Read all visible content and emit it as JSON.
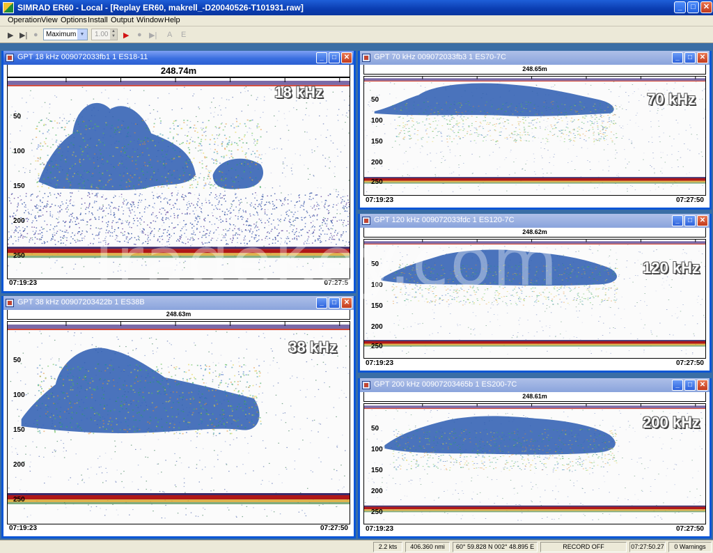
{
  "app": {
    "title": "SIMRAD ER60 - Local - [Replay ER60, makrell_-D20040526-T101931.raw]",
    "minimize": "_",
    "maximize": "□",
    "close": "✕"
  },
  "menu": [
    "Operation",
    "View",
    "Options",
    "Install",
    "Output",
    "Window",
    "Help"
  ],
  "toolbar": {
    "play": "▶",
    "step": "▶|",
    "stop": "●",
    "speed_value": "Maximum",
    "spin_value": "1.00",
    "record": "▶",
    "record_dot": "●",
    "pause": "▶|",
    "a": "A",
    "e": "E"
  },
  "windows": [
    {
      "id": "w18",
      "title": "GPT  18 kHz 009072033fb1 1 ES18-11",
      "range": "248.74m",
      "freq": "18 kHz",
      "depth_ticks": [
        "50",
        "100",
        "150",
        "200",
        "250"
      ],
      "time_start": "07:19:23",
      "time_end": "07:27:5"
    },
    {
      "id": "w38",
      "title": "GPT  38 kHz 00907203422b 1 ES38B",
      "range": "248.63m",
      "freq": "38 kHz",
      "depth_ticks": [
        "50",
        "100",
        "150",
        "200",
        "250"
      ],
      "time_start": "07:19:23",
      "time_end": "07:27:50"
    },
    {
      "id": "w70",
      "title": "GPT  70 kHz 009072033fb3 1 ES70-7C",
      "range": "248.65m",
      "freq": "70 kHz",
      "depth_ticks": [
        "50",
        "100",
        "150",
        "200",
        "250"
      ],
      "time_start": "07:19:23",
      "time_end": "07:27:50"
    },
    {
      "id": "w120",
      "title": "GPT 120 kHz 009072033fdc 1 ES120-7C",
      "range": "248.62m",
      "freq": "120 kHz",
      "depth_ticks": [
        "50",
        "100",
        "150",
        "200",
        "250"
      ],
      "time_start": "07:19:23",
      "time_end": "07:27:50"
    },
    {
      "id": "w200",
      "title": "GPT 200 kHz 00907203465b 1 ES200-7C",
      "range": "248.61m",
      "freq": "200 kHz",
      "depth_ticks": [
        "50",
        "100",
        "150",
        "200",
        "250"
      ],
      "time_start": "07:19:23",
      "time_end": "07:27:50"
    }
  ],
  "status": {
    "speed": "2.2 kts",
    "distance": "406.360 nmi",
    "position": "60° 59.828 N  002° 48.895 E",
    "record": "RECORD OFF",
    "time": "07:27:50.27",
    "warnings": "0 Warnings"
  },
  "watermark": "TradeKey.com",
  "colors": {
    "title_blue": "#0a3cb0",
    "workspace": "#3a6ea5",
    "bottom_echo": "#b01818"
  }
}
